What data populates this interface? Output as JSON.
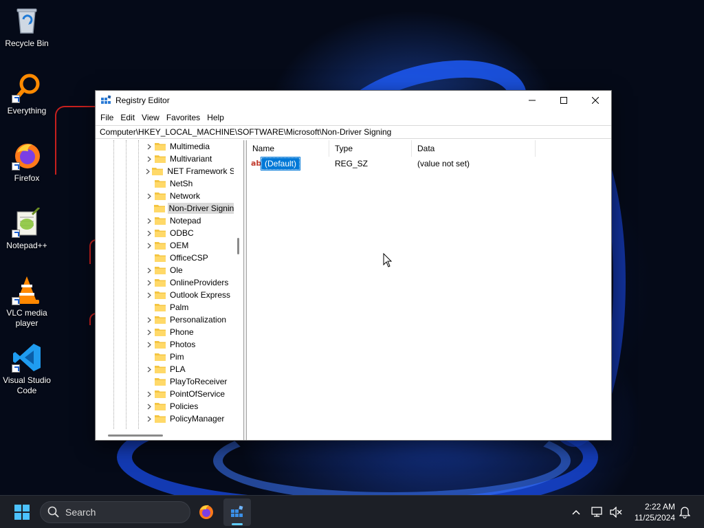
{
  "desktop": {
    "icons": [
      {
        "label": "Recycle Bin",
        "icon": "recycle-bin-icon"
      },
      {
        "label": "Everything",
        "icon": "everything-search-icon"
      },
      {
        "label": "Firefox",
        "icon": "firefox-icon"
      },
      {
        "label": "Notepad++",
        "icon": "notepad-plus-plus-icon"
      },
      {
        "label": "VLC media player",
        "icon": "vlc-icon"
      },
      {
        "label": "Visual Studio Code",
        "icon": "vscode-icon"
      }
    ]
  },
  "window": {
    "title": "Registry Editor",
    "menu": [
      "File",
      "Edit",
      "View",
      "Favorites",
      "Help"
    ],
    "address": "Computer\\HKEY_LOCAL_MACHINE\\SOFTWARE\\Microsoft\\Non-Driver Signing",
    "tree": {
      "items": [
        {
          "label": "Multimedia",
          "expandable": true
        },
        {
          "label": "Multivariant",
          "expandable": true
        },
        {
          "label": "NET Framework Setup",
          "expandable": true
        },
        {
          "label": "NetSh",
          "expandable": false
        },
        {
          "label": "Network",
          "expandable": true
        },
        {
          "label": "Non-Driver Signing",
          "expandable": false,
          "selected": true
        },
        {
          "label": "Notepad",
          "expandable": true
        },
        {
          "label": "ODBC",
          "expandable": true
        },
        {
          "label": "OEM",
          "expandable": true
        },
        {
          "label": "OfficeCSP",
          "expandable": false
        },
        {
          "label": "Ole",
          "expandable": true
        },
        {
          "label": "OnlineProviders",
          "expandable": true
        },
        {
          "label": "Outlook Express",
          "expandable": true
        },
        {
          "label": "Palm",
          "expandable": false
        },
        {
          "label": "Personalization",
          "expandable": true
        },
        {
          "label": "Phone",
          "expandable": true
        },
        {
          "label": "Photos",
          "expandable": true
        },
        {
          "label": "Pim",
          "expandable": false
        },
        {
          "label": "PLA",
          "expandable": true
        },
        {
          "label": "PlayToReceiver",
          "expandable": false
        },
        {
          "label": "PointOfService",
          "expandable": true
        },
        {
          "label": "Policies",
          "expandable": true
        },
        {
          "label": "PolicyManager",
          "expandable": true
        }
      ]
    },
    "list": {
      "columns": [
        "Name",
        "Type",
        "Data"
      ],
      "rows": [
        {
          "name": "(Default)",
          "type": "REG_SZ",
          "data": "(value not set)",
          "icon": "string-value-icon"
        }
      ]
    }
  },
  "taskbar": {
    "search_label": "Search",
    "time": "2:22 AM",
    "date": "11/25/2024"
  },
  "colors": {
    "accent": "#0078d7",
    "taskbar": "#1c1f26",
    "desktop": "#050a18"
  }
}
